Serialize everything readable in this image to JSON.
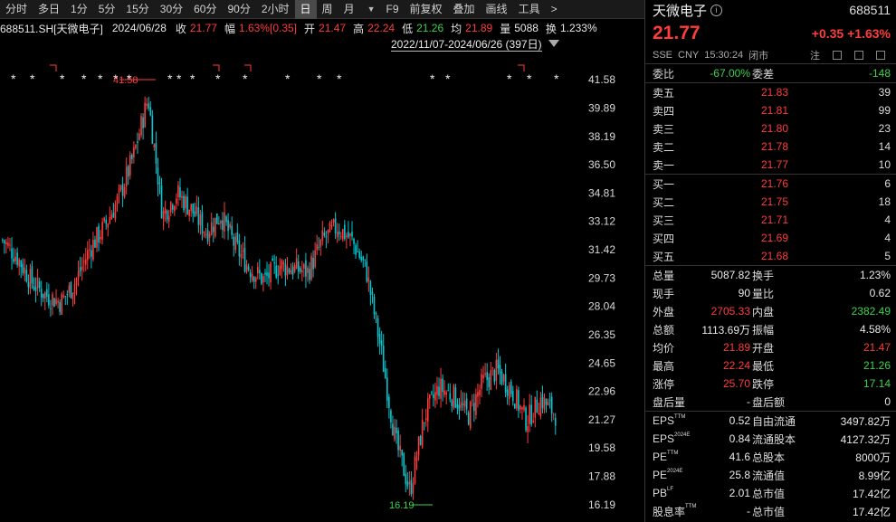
{
  "toolbar": {
    "items": [
      "分时",
      "多日",
      "1分",
      "5分",
      "15分",
      "30分",
      "60分",
      "90分",
      "2小时",
      "日",
      "周",
      "月",
      "F9",
      "前复权",
      "叠加",
      "画线",
      "工具",
      ">"
    ],
    "active": "日"
  },
  "infobar": {
    "code_name": "688511.SH[天微电子]",
    "date": "2024/06/28",
    "close_label": "收",
    "close": "21.77",
    "amp_label": "幅",
    "amp": "1.63%[0.35]",
    "open_label": "开",
    "open": "21.47",
    "high_label": "高",
    "high": "22.24",
    "low_label": "低",
    "low": "21.26",
    "avg_label": "均",
    "avg": "21.89",
    "vol_label": "量",
    "vol": "5088",
    "turn_label": "换",
    "turn": "1.233%"
  },
  "range_label": "2022/11/07-2024/06/26 (397日)",
  "chart_data": {
    "type": "candlestick",
    "y_ticks": [
      "41.58",
      "39.89",
      "38.19",
      "36.50",
      "34.81",
      "33.12",
      "31.42",
      "29.73",
      "28.04",
      "26.35",
      "24.65",
      "22.96",
      "21.27",
      "19.58",
      "17.88",
      "16.19"
    ],
    "ylim": [
      16.19,
      41.58
    ],
    "high_marker": "41.58",
    "low_marker": "16.19",
    "colors": {
      "up": "#ff3b3b",
      "down": "#00c8d2"
    },
    "trend": [
      32,
      31,
      29.5,
      28.7,
      28.3,
      29.5,
      31.5,
      32.8,
      34.5,
      37,
      40.5,
      33.5,
      34.8,
      33.8,
      32.5,
      33.5,
      31.6,
      30.3,
      29.6,
      30.5,
      30.3,
      30.1,
      32,
      32.8,
      32,
      30.2,
      25.5,
      20,
      17,
      21.5,
      23.2,
      22.7,
      21.5,
      23.5,
      24.2,
      23,
      21.2,
      22.5,
      21.6
    ]
  },
  "panel": {
    "name": "天微电子",
    "code": "688511",
    "price": "21.77",
    "change": "+0.35",
    "change_pct": "+1.63%",
    "exchange": "SSE",
    "currency": "CNY",
    "time": "15:30:24",
    "status": "闭市",
    "note_label": "注",
    "weibi_label": "委比",
    "weibi": "-67.00%",
    "weicha_label": "委差",
    "weicha": "-148",
    "asks": [
      {
        "label": "卖五",
        "price": "21.83",
        "vol": "39"
      },
      {
        "label": "卖四",
        "price": "21.81",
        "vol": "99"
      },
      {
        "label": "卖三",
        "price": "21.80",
        "vol": "23"
      },
      {
        "label": "卖二",
        "price": "21.78",
        "vol": "14"
      },
      {
        "label": "卖一",
        "price": "21.77",
        "vol": "10"
      }
    ],
    "bids": [
      {
        "label": "买一",
        "price": "21.76",
        "vol": "6"
      },
      {
        "label": "买二",
        "price": "21.75",
        "vol": "18"
      },
      {
        "label": "买三",
        "price": "21.71",
        "vol": "4"
      },
      {
        "label": "买四",
        "price": "21.69",
        "vol": "4"
      },
      {
        "label": "买五",
        "price": "21.68",
        "vol": "5"
      }
    ],
    "stats": [
      {
        "l1": "总量",
        "v1": "5087.82",
        "c1": "white",
        "l2": "换手",
        "v2": "1.23%",
        "c2": "white"
      },
      {
        "l1": "现手",
        "v1": "90",
        "c1": "white",
        "l2": "量比",
        "v2": "0.62",
        "c2": "white"
      },
      {
        "l1": "外盘",
        "v1": "2705.33",
        "c1": "red",
        "l2": "内盘",
        "v2": "2382.49",
        "c2": "green"
      },
      {
        "l1": "总额",
        "v1": "1113.69万",
        "c1": "white",
        "l2": "振幅",
        "v2": "4.58%",
        "c2": "white"
      },
      {
        "l1": "均价",
        "v1": "21.89",
        "c1": "red",
        "l2": "开盘",
        "v2": "21.47",
        "c2": "red"
      },
      {
        "l1": "最高",
        "v1": "22.24",
        "c1": "red",
        "l2": "最低",
        "v2": "21.26",
        "c2": "green"
      },
      {
        "l1": "涨停",
        "v1": "25.70",
        "c1": "red",
        "l2": "跌停",
        "v2": "17.14",
        "c2": "green"
      },
      {
        "l1": "盘后量",
        "v1": "-",
        "c1": "white",
        "l2": "盘后额",
        "v2": "0",
        "c2": "white"
      }
    ],
    "fund": [
      {
        "l1": "EPS",
        "s1": "TTM",
        "v1": "0.52",
        "l2": "自由流通",
        "v2": "3497.82万"
      },
      {
        "l1": "EPS",
        "s1": "2024E",
        "v1": "0.84",
        "l2": "流通股本",
        "v2": "4127.32万"
      },
      {
        "l1": "PE",
        "s1": "TTM",
        "v1": "41.6",
        "l2": "总股本",
        "v2": "8000万"
      },
      {
        "l1": "PE",
        "s1": "2024E",
        "v1": "25.8",
        "l2": "流通值",
        "v2": "8.99亿"
      },
      {
        "l1": "PB",
        "s1": "LF",
        "v1": "2.01",
        "l2": "总市值",
        "v2": "17.42亿"
      },
      {
        "l1": "股息率",
        "s1": "TTM",
        "v1": "-",
        "l2": "总市值",
        "v2": "17.42亿"
      }
    ]
  }
}
